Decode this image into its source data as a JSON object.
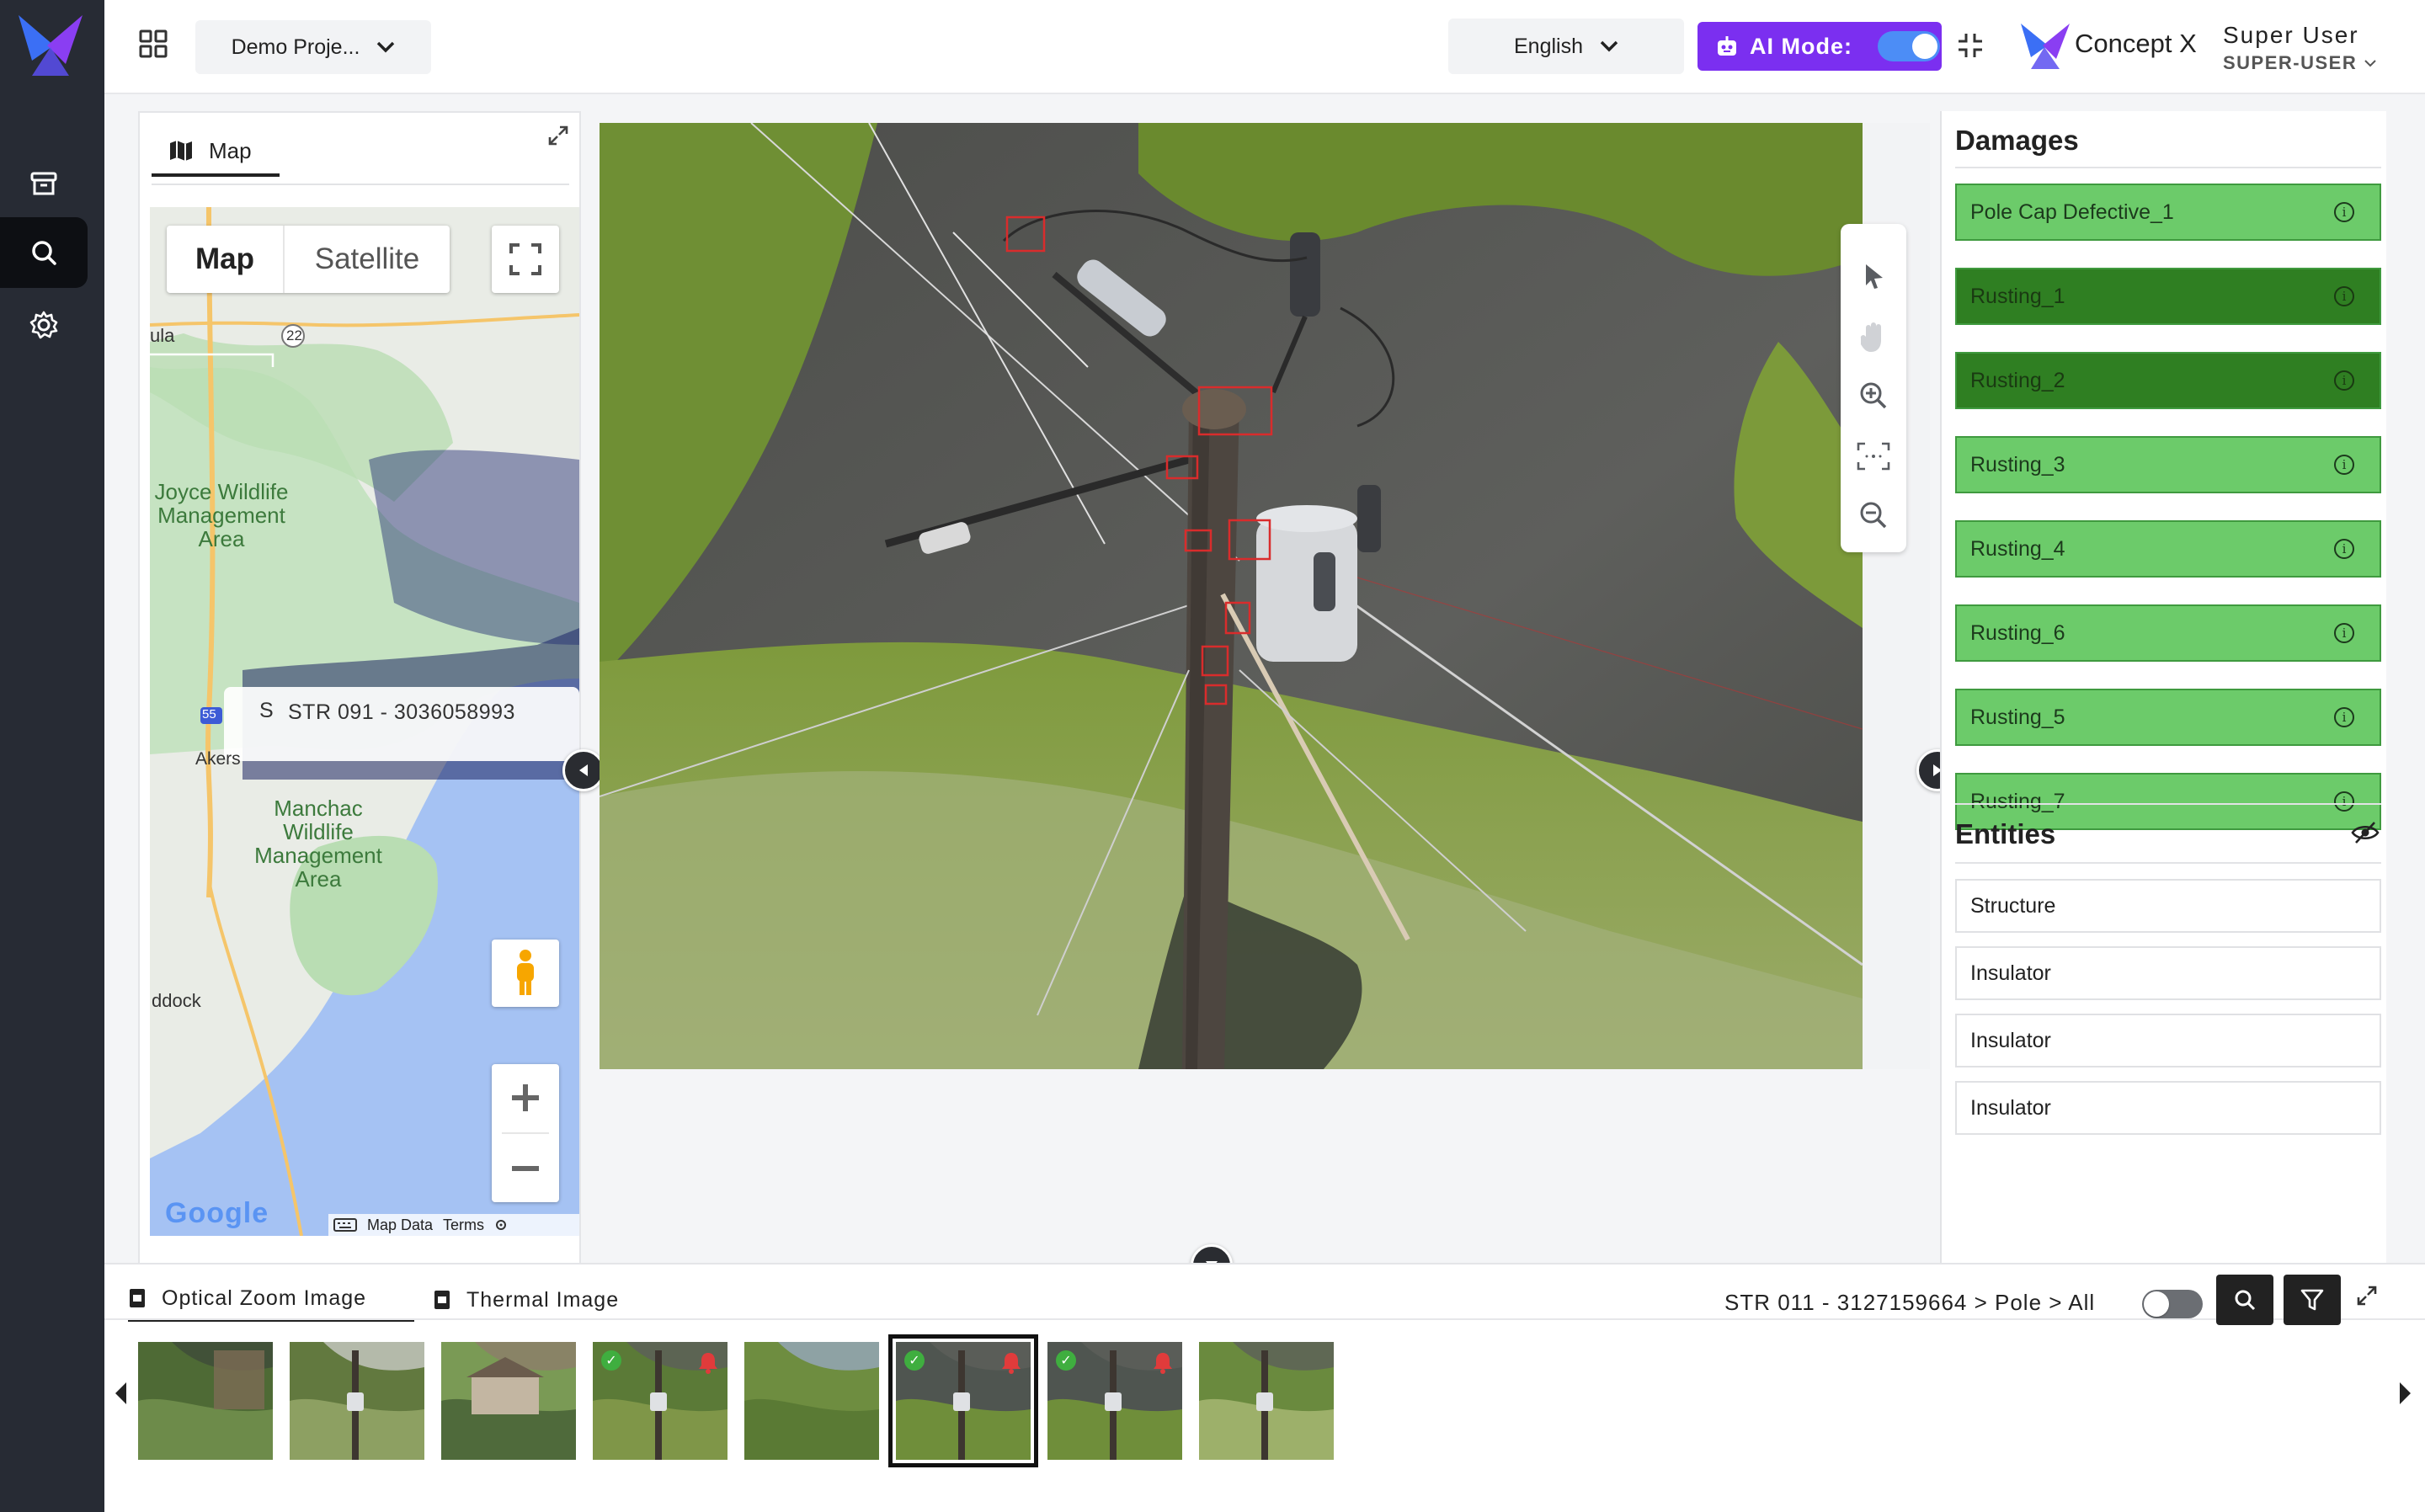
{
  "colors": {
    "sidebar": "#272b34",
    "accent_purple": "#7b2ff0",
    "damage_light": "#6ccb6a",
    "damage_dark": "#2f7f22",
    "bbox_red": "#d92c2c"
  },
  "topbar": {
    "project": "Demo Proje...",
    "language": "English",
    "ai_mode_label": "AI Mode:",
    "brand": "Concept X",
    "user_name": "Super User",
    "user_role": "SUPER-USER"
  },
  "map": {
    "tab_label": "Map",
    "type_map": "Map",
    "type_satellite": "Satellite",
    "labels": {
      "road_22": "22",
      "ula": "ula",
      "joyce": "Joyce Wildlife\nManagement\nArea",
      "manchac": "Manchac\nWildlife\nManagement\nArea",
      "akers": "Akers",
      "ddock": "ddock",
      "i55": "55"
    },
    "popup_prefix": "S",
    "popup_text": "STR 091 - 3036058993",
    "google": "Google",
    "map_data": "Map Data",
    "terms": "Terms"
  },
  "damages": {
    "title": "Damages",
    "items": [
      {
        "label": "Pole Cap Defective_1",
        "shade": "light"
      },
      {
        "label": "Rusting_1",
        "shade": "dark"
      },
      {
        "label": "Rusting_2",
        "shade": "dark"
      },
      {
        "label": "Rusting_3",
        "shade": "light"
      },
      {
        "label": "Rusting_4",
        "shade": "light"
      },
      {
        "label": "Rusting_6",
        "shade": "light"
      },
      {
        "label": "Rusting_5",
        "shade": "light"
      },
      {
        "label": "Rusting_7",
        "shade": "light"
      }
    ]
  },
  "entities": {
    "title": "Entities",
    "items": [
      "Structure",
      "Insulator",
      "Insulator",
      "Insulator"
    ]
  },
  "bottom": {
    "tab_optical": "Optical Zoom Image",
    "tab_thermal": "Thermal Image",
    "breadcrumb": "STR 011 - 3127159664 > Pole > All",
    "thumbnails": [
      {
        "scene": "dock-water",
        "check": false,
        "bell": false,
        "selected": false
      },
      {
        "scene": "pole-grass",
        "check": false,
        "bell": false,
        "selected": false
      },
      {
        "scene": "house-wetland",
        "check": false,
        "bell": false,
        "selected": false
      },
      {
        "scene": "pole-top",
        "check": true,
        "bell": true,
        "selected": false
      },
      {
        "scene": "marsh",
        "check": false,
        "bell": false,
        "selected": false
      },
      {
        "scene": "pole-water",
        "check": true,
        "bell": true,
        "selected": true
      },
      {
        "scene": "pole-water",
        "check": true,
        "bell": true,
        "selected": false
      },
      {
        "scene": "pole-aerial",
        "check": false,
        "bell": false,
        "selected": false
      }
    ]
  }
}
